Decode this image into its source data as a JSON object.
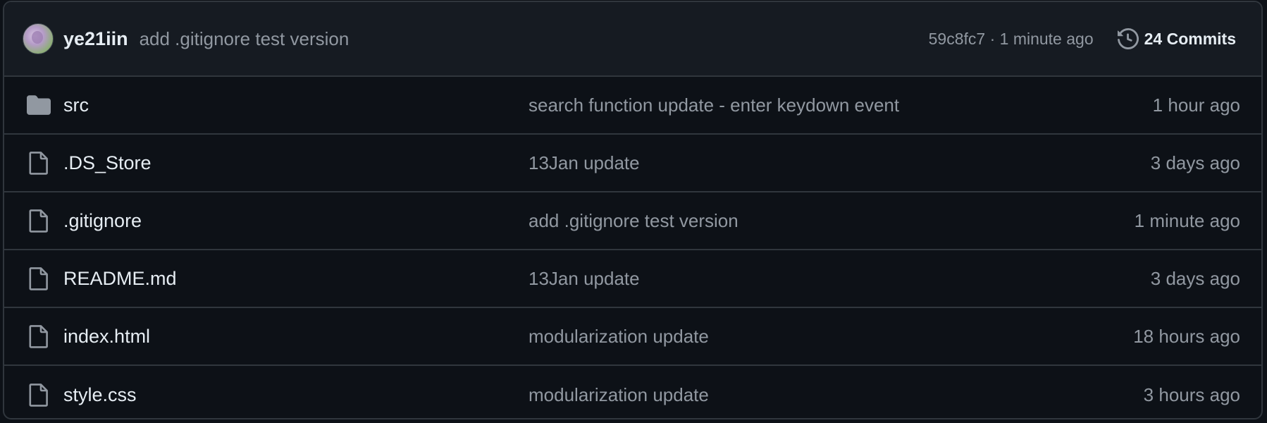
{
  "header": {
    "author": "ye21iin",
    "commit_message": "add .gitignore test version",
    "commit_meta": "59c8fc7 · 1 minute ago",
    "commits_label": "24 Commits",
    "avatar_icon": "user-avatar",
    "history_icon": "history-icon"
  },
  "files": [
    {
      "name": "src",
      "type": "folder",
      "icon": "folder-icon",
      "message": "search function update - enter keydown event",
      "time": "1 hour ago"
    },
    {
      "name": ".DS_Store",
      "type": "file",
      "icon": "file-icon",
      "message": "13Jan update",
      "time": "3 days ago"
    },
    {
      "name": ".gitignore",
      "type": "file",
      "icon": "file-icon",
      "message": "add .gitignore test version",
      "time": "1 minute ago"
    },
    {
      "name": "README.md",
      "type": "file",
      "icon": "file-icon",
      "message": "13Jan update",
      "time": "3 days ago"
    },
    {
      "name": "index.html",
      "type": "file",
      "icon": "file-icon",
      "message": "modularization update",
      "time": "18 hours ago"
    },
    {
      "name": "style.css",
      "type": "file",
      "icon": "file-icon",
      "message": "modularization update",
      "time": "3 hours ago"
    }
  ],
  "colors": {
    "background": "#0d1117",
    "header_bg": "#161b22",
    "border": "#30363d",
    "text_primary": "#e6edf3",
    "text_muted": "#9198a1",
    "icon": "#9198a1"
  }
}
